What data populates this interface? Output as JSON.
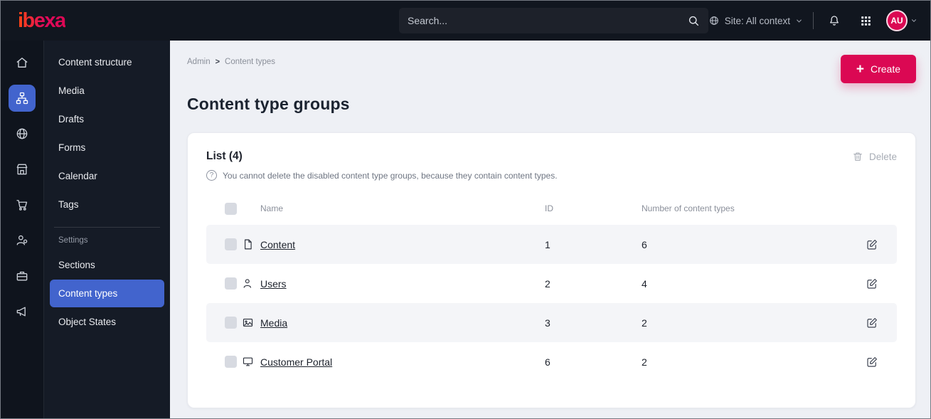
{
  "topbar": {
    "logo": "ibexa",
    "search_placeholder": "Search...",
    "site_context": "Site: All context",
    "avatar_initials": "AU"
  },
  "icons": {
    "plus": "+",
    "help": "?",
    "breadcrumb_separator": ">"
  },
  "sidebar": {
    "section_label": "Settings",
    "items": [
      {
        "label": "Content structure"
      },
      {
        "label": "Media"
      },
      {
        "label": "Drafts"
      },
      {
        "label": "Forms"
      },
      {
        "label": "Calendar"
      },
      {
        "label": "Tags"
      },
      {
        "label": "Sections"
      },
      {
        "label": "Content types"
      },
      {
        "label": "Object States"
      }
    ],
    "active_item": "Content types"
  },
  "breadcrumb": {
    "items": [
      "Admin",
      "Content types"
    ]
  },
  "header": {
    "title": "Content type groups",
    "create_label": "Create"
  },
  "panel": {
    "list_title": "List (4)",
    "help_text": "You cannot delete the disabled content type groups, because they contain content types.",
    "delete_label": "Delete"
  },
  "table": {
    "columns": [
      "Name",
      "ID",
      "Number of content types"
    ],
    "rows": [
      {
        "name": "Content",
        "id": "1",
        "count": "6",
        "icon": "file-icon"
      },
      {
        "name": "Users",
        "id": "2",
        "count": "4",
        "icon": "user-icon"
      },
      {
        "name": "Media",
        "id": "3",
        "count": "2",
        "icon": "image-icon"
      },
      {
        "name": "Customer Portal",
        "id": "6",
        "count": "2",
        "icon": "monitor-icon"
      }
    ]
  },
  "colors": {
    "accent_pink": "#db0853",
    "active_blue": "#4264cd",
    "dark_bg": "#11161f",
    "main_bg": "#eef0f5",
    "row_stripe": "#f4f5f8"
  }
}
